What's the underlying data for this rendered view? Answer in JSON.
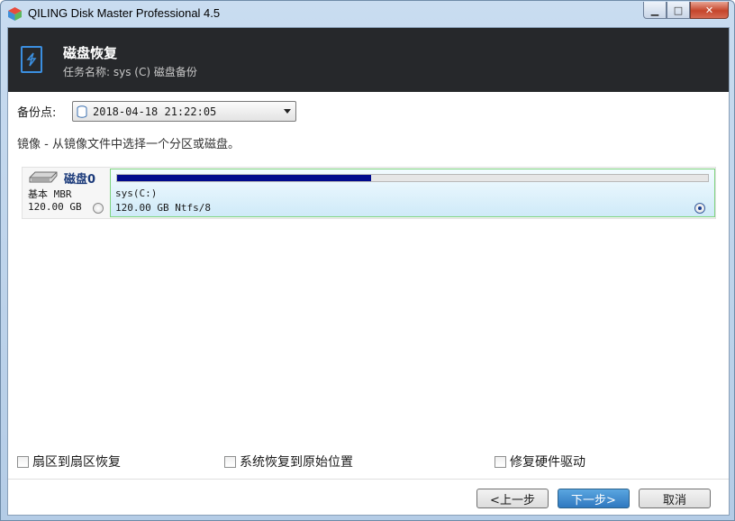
{
  "window": {
    "title": "QILING Disk Master Professional 4.5"
  },
  "header": {
    "title": "磁盘恢复",
    "subtitle": "任务名称: sys (C) 磁盘备份"
  },
  "backup_point": {
    "label": "备份点:",
    "value": "2018-04-18 21:22:05"
  },
  "hint": "镜像 - 从镜像文件中选择一个分区或磁盘。",
  "disk": {
    "name": "磁盘0",
    "type": "基本 MBR",
    "size": "120.00 GB",
    "partition": {
      "name": "sys(C:)",
      "detail": "120.00 GB Ntfs/8",
      "used_fraction": 0.43,
      "selected": true
    }
  },
  "options": [
    {
      "label": "扇区到扇区恢复",
      "checked": false
    },
    {
      "label": "系统恢复到原始位置",
      "checked": false
    },
    {
      "label": "修复硬件驱动",
      "checked": false
    }
  ],
  "buttons": {
    "back": "<上一步",
    "next": "下一步>",
    "cancel": "取消"
  },
  "colors": {
    "header_bg": "#26282b",
    "usage_fill": "#000a8c",
    "partition_border": "#7fd47f",
    "accent": "#3b8fe0"
  }
}
